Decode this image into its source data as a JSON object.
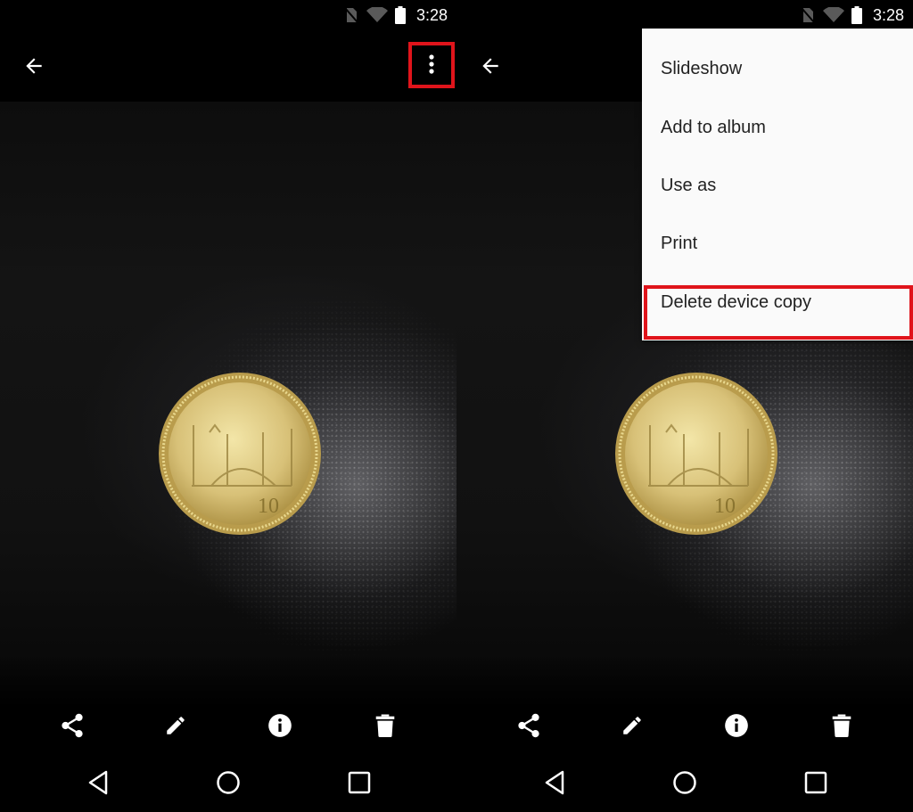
{
  "status_bar": {
    "time": "3:28",
    "icons": [
      "no-sim-icon",
      "wifi-icon",
      "battery-icon"
    ]
  },
  "app_bar": {
    "back_icon": "arrow-back-icon",
    "more_icon": "more-vert-icon"
  },
  "photo": {
    "subject": "Gold-colored 10 rupee coin on dark textured surface",
    "coin_denomination": "10"
  },
  "actions": [
    {
      "name": "share",
      "icon": "share-icon"
    },
    {
      "name": "edit",
      "icon": "edit-icon"
    },
    {
      "name": "info",
      "icon": "info-icon"
    },
    {
      "name": "delete",
      "icon": "trash-icon"
    }
  ],
  "nav": [
    {
      "name": "back",
      "icon": "nav-back-icon"
    },
    {
      "name": "home",
      "icon": "nav-home-icon"
    },
    {
      "name": "recents",
      "icon": "nav-recents-icon"
    }
  ],
  "overflow_menu": {
    "items": [
      {
        "label": "Slideshow"
      },
      {
        "label": "Add to album"
      },
      {
        "label": "Use as"
      },
      {
        "label": "Print"
      },
      {
        "label": "Delete device copy",
        "highlighted": true
      }
    ]
  },
  "highlight_color": "#e0141b"
}
